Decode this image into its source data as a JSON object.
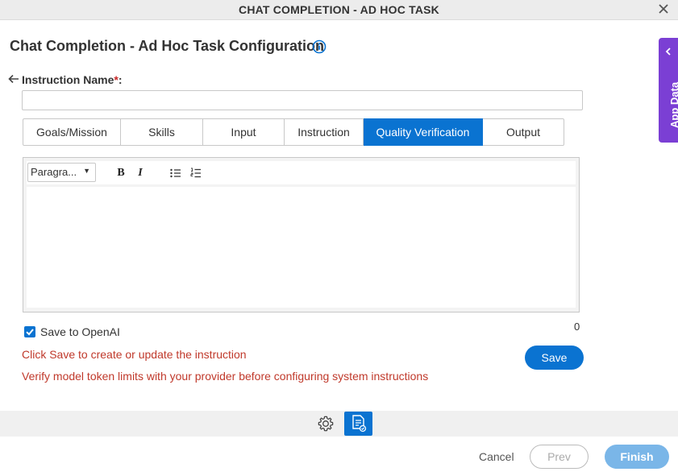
{
  "window": {
    "title": "CHAT COMPLETION - AD HOC TASK"
  },
  "page": {
    "heading": "Chat Completion - Ad Hoc Task Configuration"
  },
  "instruction_name": {
    "label": "Instruction Name",
    "required_mark": "*",
    "colon": ":",
    "value": "",
    "placeholder": ""
  },
  "tabs": [
    {
      "label": "Goals/Mission",
      "active": false
    },
    {
      "label": "Skills",
      "active": false
    },
    {
      "label": "Input",
      "active": false
    },
    {
      "label": "Instruction",
      "active": false
    },
    {
      "label": "Quality Verification",
      "active": true
    },
    {
      "label": "Output",
      "active": false
    }
  ],
  "editor": {
    "paragraph_select": "Paragra...",
    "bold_label": "B",
    "italic_label": "I",
    "content": ""
  },
  "save_to_openai": {
    "label": "Save to OpenAI",
    "checked": true
  },
  "char_count": "0",
  "messages": {
    "save_hint": "Click Save to create or update the instruction",
    "token_warning": "Verify model token limits with your provider before configuring system instructions"
  },
  "buttons": {
    "save": "Save",
    "cancel": "Cancel",
    "prev": "Prev",
    "finish": "Finish"
  },
  "side_panel": {
    "label": "App Data"
  },
  "icons": [
    "close-icon",
    "info-icon",
    "back-arrow-icon",
    "caret-down-icon",
    "bullet-list-icon",
    "numbered-list-icon",
    "gear-icon",
    "document-icon",
    "chevron-left-icon"
  ],
  "colors": {
    "accent": "#0a73d1",
    "app_data": "#7b3fd4",
    "error_text": "#c0392b",
    "finish_disabled": "#7ab6e8"
  }
}
